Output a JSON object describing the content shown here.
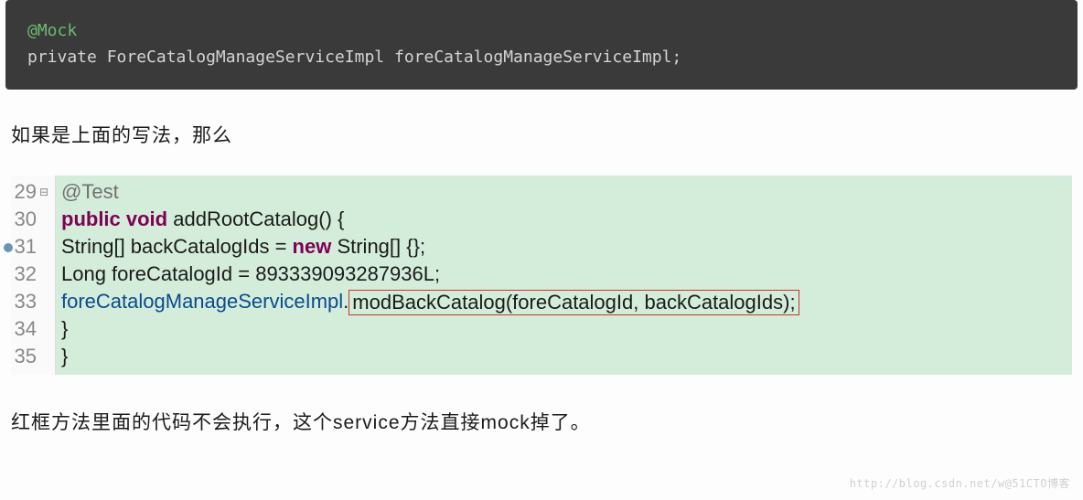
{
  "darkCode": {
    "annotation": "@Mock",
    "keyword": "private",
    "type": "ForeCatalogManageServiceImpl",
    "var": "foreCatalogManageServiceImpl;"
  },
  "para1": "如果是上面的写法，那么",
  "gutter": {
    "l1": "29",
    "l2": "30",
    "l3": "31",
    "l4": "32",
    "l5": "33",
    "l6": "34",
    "l7": "35",
    "fold1": "⊟",
    "fold2": " "
  },
  "code": {
    "l1_ann": "@Test",
    "l2_kw1": "public void",
    "l2_plain": " addRootCatalog() {",
    "l3_a": "String[] backCatalogIds = ",
    "l3_kw": "new",
    "l3_b": " String[] {};",
    "l4": "Long foreCatalogId = 893339093287936L;",
    "l5_var": "foreCatalogManageServiceImpl",
    "l5_dot": ".",
    "l5_box": "modBackCatalog(foreCatalogId, backCatalogIds);",
    "l6": "}",
    "l7": "}"
  },
  "para2": "红框方法里面的代码不会执行，这个service方法直接mock掉了。",
  "watermark": "http://blog.csdn.net/w@51CTO博客"
}
